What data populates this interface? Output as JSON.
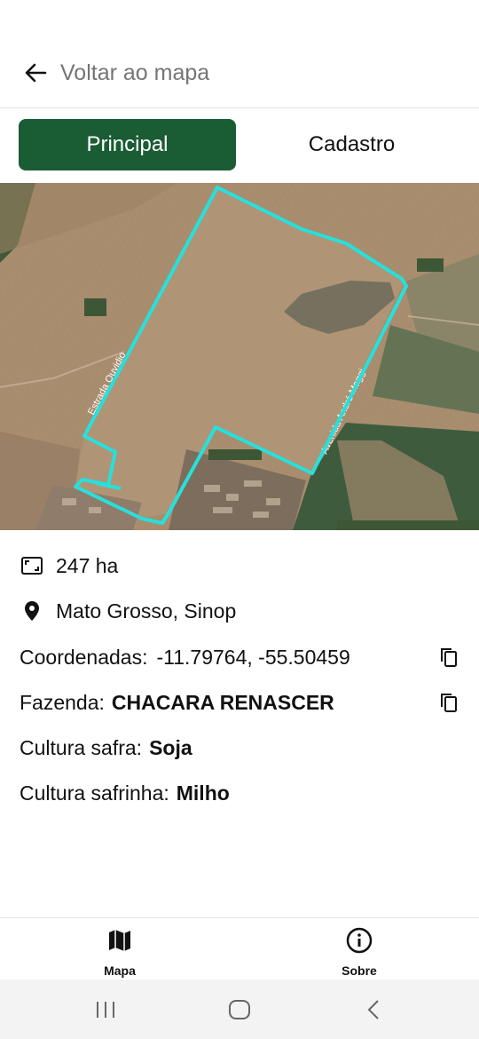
{
  "header": {
    "back_label": "Voltar ao mapa"
  },
  "tabs": [
    {
      "label": "Principal",
      "active": true
    },
    {
      "label": "Cadastro",
      "active": false
    }
  ],
  "map": {
    "road_labels": [
      "Estrada Ouvidio",
      "Avenida André Maggi"
    ],
    "outline_color": "#27e0dc"
  },
  "info": {
    "area": "247 ha",
    "location": "Mato Grosso, Sinop",
    "coords_label": "Coordenadas:",
    "coords_value": "-11.79764, -55.50459",
    "farm_label": "Fazenda:",
    "farm_value": "CHACARA RENASCER",
    "safra_label": "Cultura safra:",
    "safra_value": "Soja",
    "safrinha_label": "Cultura safrinha:",
    "safrinha_value": "Milho"
  },
  "bottom_nav": [
    {
      "label": "Mapa",
      "icon": "map-icon"
    },
    {
      "label": "Sobre",
      "icon": "info-icon"
    }
  ],
  "system_nav": {
    "icons": [
      "recent-apps-icon",
      "home-icon",
      "back-icon"
    ]
  },
  "colors": {
    "accent": "#1a5c34",
    "outline": "#27e0dc"
  }
}
